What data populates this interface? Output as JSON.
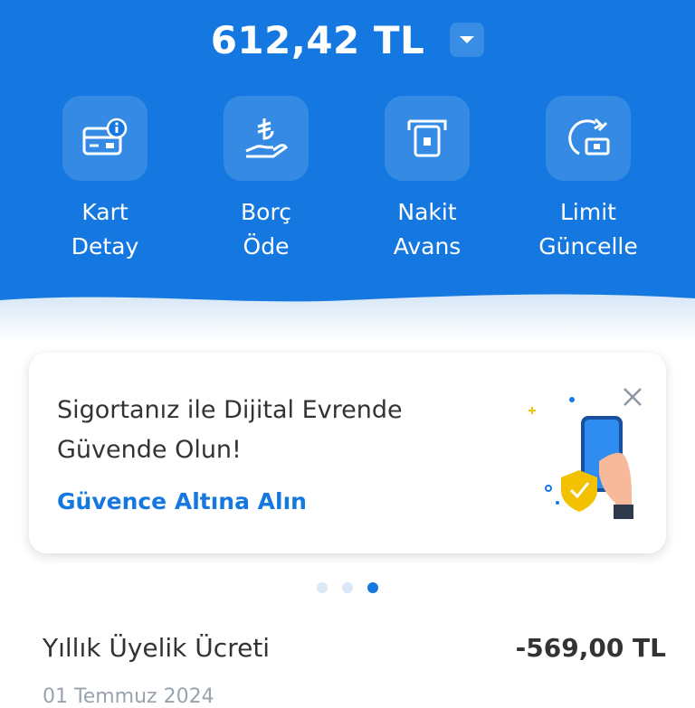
{
  "header": {
    "balance": "612,42 TL",
    "dropdown_icon": "chevron-down-icon"
  },
  "actions": [
    {
      "label_line1": "Kart",
      "label_line2": "Detay",
      "icon": "card-info-icon"
    },
    {
      "label_line1": "Borç",
      "label_line2": "Öde",
      "icon": "lira-hand-icon"
    },
    {
      "label_line1": "Nakit",
      "label_line2": "Avans",
      "icon": "atm-cash-icon"
    },
    {
      "label_line1": "Limit",
      "label_line2": "Güncelle",
      "icon": "limit-refresh-icon"
    }
  ],
  "promo": {
    "title": "Sigortanız ile Dijital Evrende Güvende Olun!",
    "link": "Güvence Altına Alın",
    "close_icon": "close-icon"
  },
  "carousel": {
    "total": 3,
    "active": 3
  },
  "transaction": {
    "title": "Yıllık Üyelik Ücreti",
    "amount": "-569,00 TL",
    "date": "01 Temmuz 2024"
  },
  "colors": {
    "brand_blue": "#1478e0",
    "text_dark": "#333333"
  }
}
